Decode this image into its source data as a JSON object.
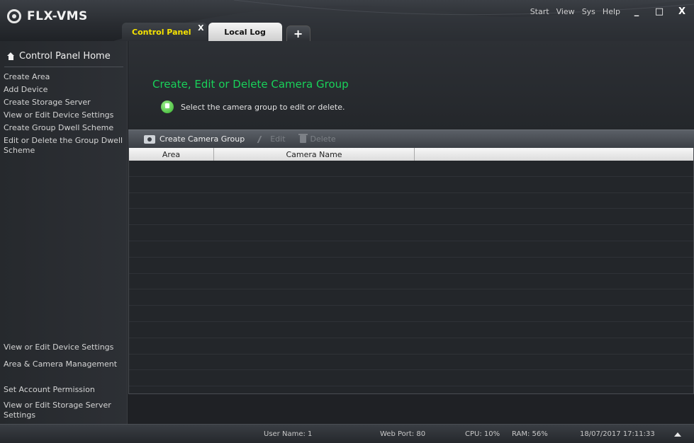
{
  "app": {
    "title": "FLX-VMS"
  },
  "tabs": {
    "active_label": "Control Panel",
    "close_label": "X",
    "local_log_label": "Local Log",
    "add_label": "+"
  },
  "menu": {
    "items": [
      "Start",
      "View",
      "Sys",
      "Help"
    ]
  },
  "window_controls": {
    "minimize": "_",
    "maximize": "□",
    "close": "X"
  },
  "sidebar": {
    "home_label": "Control Panel Home",
    "top_links": [
      "Create Area",
      "Add Device",
      "Create Storage Server",
      "View or Edit Device Settings",
      "Create Group Dwell Scheme",
      "Edit or Delete the Group Dwell Scheme"
    ],
    "bottom_links": [
      "View or Edit Device Settings",
      "Area & Camera Management",
      "Set Account Permission",
      "View or Edit Storage Server Settings"
    ]
  },
  "main": {
    "title": "Create, Edit or Delete Camera Group",
    "hint": "Select the camera group to edit or delete.",
    "toolbar": {
      "create_label": "Create Camera Group",
      "edit_label": "Edit",
      "delete_label": "Delete"
    },
    "table": {
      "columns": [
        "Area",
        "Camera Name",
        ""
      ]
    }
  },
  "status": {
    "user": "User Name: 1",
    "web_port": "Web Port: 80",
    "cpu": "CPU: 10%",
    "ram": "RAM: 56%",
    "datetime": "18/07/2017 17:11:33"
  },
  "colors": {
    "title_green": "#19d15a",
    "active_tab_yellow": "#f7e300"
  }
}
